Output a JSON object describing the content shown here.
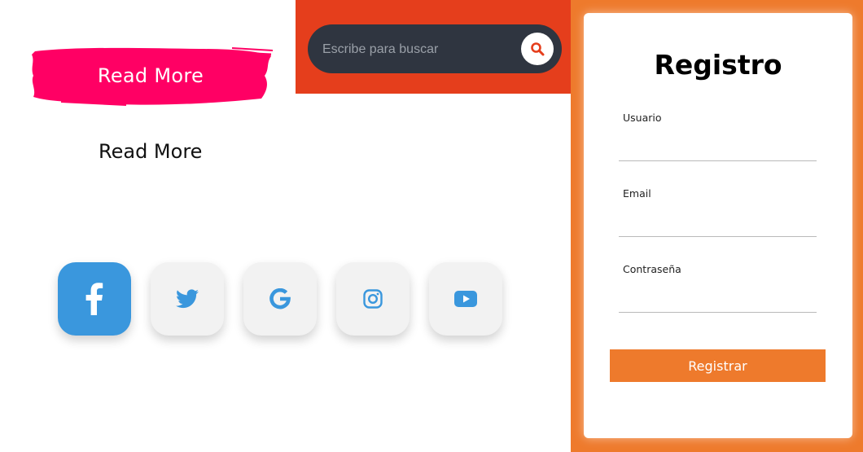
{
  "brush_button": {
    "label": "Read More",
    "color": "#ff0064"
  },
  "plain_link": {
    "label": "Read More"
  },
  "search": {
    "placeholder": "Escribe para buscar",
    "value": "",
    "accent": "#e53e1c",
    "box_color": "#2f3540"
  },
  "social": {
    "items": [
      {
        "name": "facebook",
        "icon": "facebook-icon",
        "active": true
      },
      {
        "name": "twitter",
        "icon": "twitter-icon",
        "active": false
      },
      {
        "name": "google",
        "icon": "google-icon",
        "active": false
      },
      {
        "name": "instagram",
        "icon": "instagram-icon",
        "active": false
      },
      {
        "name": "youtube",
        "icon": "youtube-icon",
        "active": false
      }
    ],
    "accent": "#3a97dd"
  },
  "register": {
    "title": "Registro",
    "fields": [
      {
        "label": "Usuario",
        "value": ""
      },
      {
        "label": "Email",
        "value": ""
      },
      {
        "label": "Contraseña",
        "value": ""
      }
    ],
    "submit_label": "Registrar",
    "accent": "#ee7a2c"
  }
}
